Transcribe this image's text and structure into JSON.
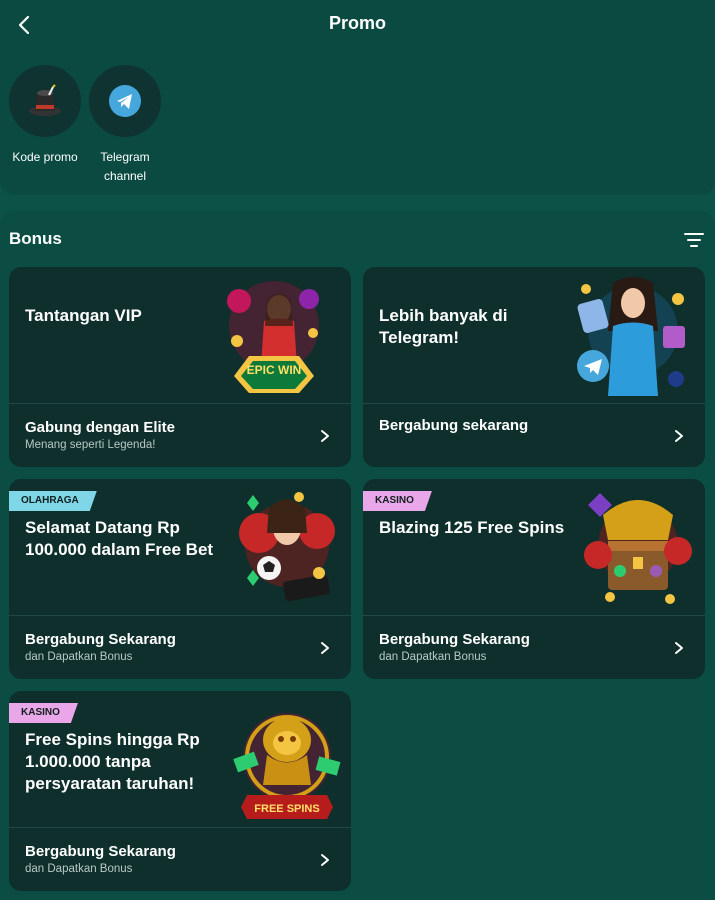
{
  "header": {
    "title": "Promo",
    "back_icon": "chevron-left-icon"
  },
  "shortcuts": [
    {
      "label": "Kode promo",
      "icon": "magic-hat-icon"
    },
    {
      "label": "Telegram channel",
      "icon": "telegram-icon"
    }
  ],
  "bonus": {
    "title": "Bonus",
    "filter_icon": "filter-icon",
    "cards": [
      {
        "title": "Tantangan VIP",
        "footer_title": "Gabung dengan Elite",
        "footer_sub": "Menang seperti Legenda!",
        "tag": "",
        "art": "epic-win-slot-art",
        "art_text": "EPIC WIN"
      },
      {
        "title": "Lebih banyak di Telegram!",
        "footer_title": "Bergabung sekarang",
        "footer_sub": "",
        "tag": "",
        "art": "telegram-girl-art"
      },
      {
        "title": "Selamat Datang Rp 100.000 dalam Free Bet",
        "footer_title": "Bergabung Sekarang",
        "footer_sub": "dan Dapatkan Bonus",
        "tag": "OLAHRAGA",
        "art": "football-girl-art"
      },
      {
        "title": "Blazing 125 Free Spins",
        "footer_title": "Bergabung Sekarang",
        "footer_sub": "dan Dapatkan Bonus",
        "tag": "KASINO",
        "art": "treasure-chest-art"
      },
      {
        "title": "Free Spins hingga Rp 1.000.000 tanpa persyaratan taruhan!",
        "footer_title": "Bergabung Sekarang",
        "footer_sub": "dan Dapatkan Bonus",
        "tag": "KASINO",
        "art": "golden-lion-free-spins-art",
        "art_text": "FREE SPINS"
      }
    ]
  },
  "colors": {
    "background": "#0d5247",
    "card": "#0e2f2b",
    "tag_sport": "#7fd6e6",
    "tag_casino": "#e9a6e8"
  }
}
